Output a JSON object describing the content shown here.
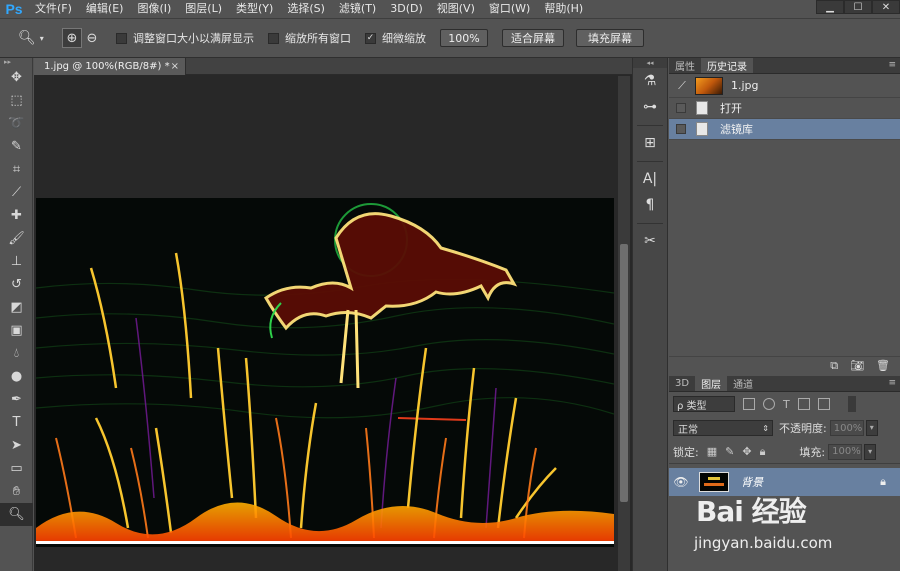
{
  "app": {
    "logo": "Ps"
  },
  "menu": [
    "文件(F)",
    "编辑(E)",
    "图像(I)",
    "图层(L)",
    "类型(Y)",
    "选择(S)",
    "滤镜(T)",
    "3D(D)",
    "视图(V)",
    "窗口(W)",
    "帮助(H)"
  ],
  "window_controls": {
    "minimize": "▁",
    "maximize": "☐",
    "close": "✕"
  },
  "options": {
    "resize_windows_label": "调整窗口大小以满屏显示",
    "zoom_all_windows_label": "缩放所有窗口",
    "scrubby_zoom_label": "细微缩放",
    "zoom_level_button": "100%",
    "fit_screen_button": "适合屏幕",
    "fill_screen_button": "填充屏幕"
  },
  "document": {
    "tab_title": "1.jpg @ 100%(RGB/8#) *",
    "close": "×"
  },
  "history_panel": {
    "tabs": [
      "属性",
      "历史记录"
    ],
    "snapshot_name": "1.jpg",
    "states": [
      "打开",
      "滤镜库"
    ]
  },
  "layers_panel": {
    "tabs": [
      "3D",
      "图层",
      "通道"
    ],
    "kind_filter": "ρ 类型",
    "blend_mode": "正常",
    "opacity_label": "不透明度:",
    "opacity_value": "100%",
    "lock_label": "锁定:",
    "fill_label": "填充:",
    "fill_value": "100%",
    "layer_name": "背景"
  },
  "watermark": {
    "main": "Bai 经验",
    "sub": "jingyan.baidu.com"
  },
  "colors": {
    "accent_selected": "#6880a0",
    "panel_bg": "#535353",
    "canvas_bg": "#282828",
    "logo_blue": "#31a8ff"
  }
}
